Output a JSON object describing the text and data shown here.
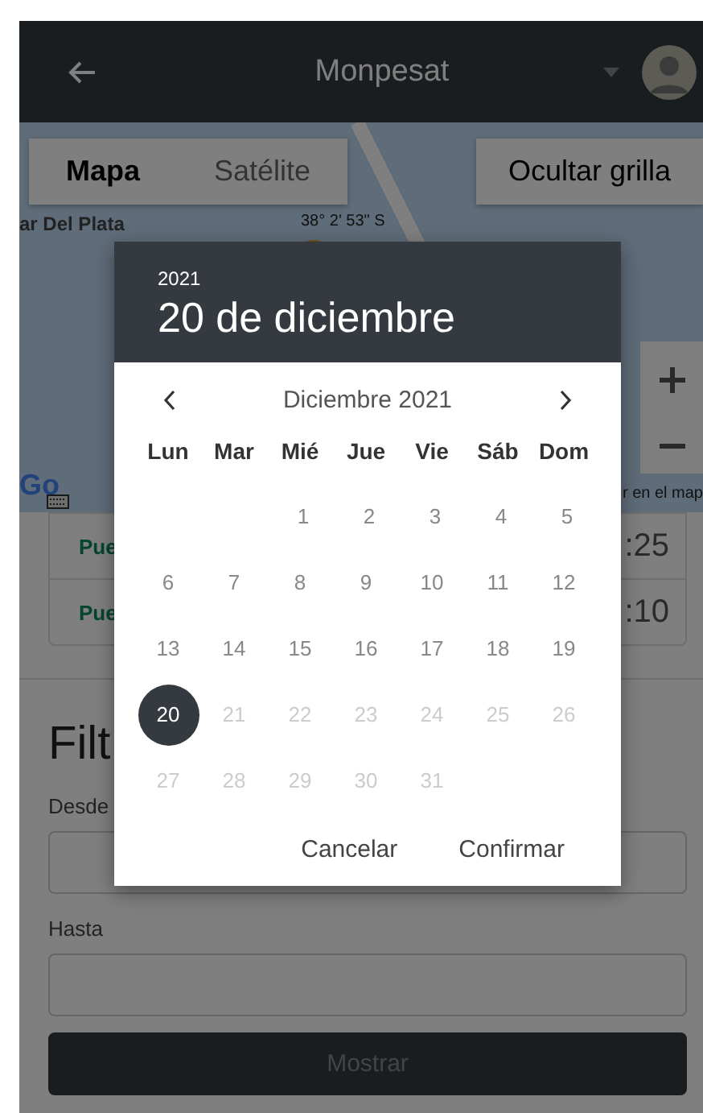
{
  "app_bar": {
    "title": "Monpesat"
  },
  "map": {
    "tabs": [
      {
        "label": "Mapa",
        "selected": true
      },
      {
        "label": "Satélite",
        "selected": false
      }
    ],
    "toggle_button": "Ocultar grilla",
    "place_label": "ar Del Plata",
    "coordinates": "38° 2' 53\" S",
    "logo": "Go",
    "attribution": "r en el map"
  },
  "table": {
    "rows": [
      {
        "column_1": "Pue",
        "column_2": ":25"
      },
      {
        "column_1": "Pue",
        "column_2": ":10"
      }
    ]
  },
  "filter": {
    "heading": "Filt",
    "fields": [
      {
        "label": "Desde"
      },
      {
        "label": "Hasta"
      }
    ],
    "submit": "Mostrar"
  },
  "date_picker": {
    "year": "2021",
    "date": "20 de diciembre",
    "month": "Diciembre 2021",
    "weekdays": [
      "Lun",
      "Mar",
      "Mié",
      "Jue",
      "Vie",
      "Sáb",
      "Dom"
    ],
    "weeks": [
      {
        "kind": "first",
        "days": [
          {
            "label": "1",
            "disabled": false,
            "selected": false
          },
          {
            "label": "2",
            "disabled": false,
            "selected": false
          },
          {
            "label": "3",
            "disabled": false,
            "selected": false
          },
          {
            "label": "4",
            "disabled": false,
            "selected": false
          },
          {
            "label": "5",
            "disabled": false,
            "selected": false
          }
        ]
      },
      {
        "kind": "full",
        "days": [
          {
            "label": "6",
            "disabled": false,
            "selected": false
          },
          {
            "label": "7",
            "disabled": false,
            "selected": false
          },
          {
            "label": "8",
            "disabled": false,
            "selected": false
          },
          {
            "label": "9",
            "disabled": false,
            "selected": false
          },
          {
            "label": "10",
            "disabled": false,
            "selected": false
          },
          {
            "label": "11",
            "disabled": false,
            "selected": false
          },
          {
            "label": "12",
            "disabled": false,
            "selected": false
          }
        ]
      },
      {
        "kind": "full",
        "days": [
          {
            "label": "13",
            "disabled": false,
            "selected": false
          },
          {
            "label": "14",
            "disabled": false,
            "selected": false
          },
          {
            "label": "15",
            "disabled": false,
            "selected": false
          },
          {
            "label": "16",
            "disabled": false,
            "selected": false
          },
          {
            "label": "17",
            "disabled": false,
            "selected": false
          },
          {
            "label": "18",
            "disabled": false,
            "selected": false
          },
          {
            "label": "19",
            "disabled": false,
            "selected": false
          }
        ]
      },
      {
        "kind": "full",
        "days": [
          {
            "label": "20",
            "disabled": false,
            "selected": true
          },
          {
            "label": "21",
            "disabled": true,
            "selected": false
          },
          {
            "label": "22",
            "disabled": true,
            "selected": false
          },
          {
            "label": "23",
            "disabled": true,
            "selected": false
          },
          {
            "label": "24",
            "disabled": true,
            "selected": false
          },
          {
            "label": "25",
            "disabled": true,
            "selected": false
          },
          {
            "label": "26",
            "disabled": true,
            "selected": false
          }
        ]
      },
      {
        "kind": "last",
        "days": [
          {
            "label": "27",
            "disabled": true,
            "selected": false
          },
          {
            "label": "28",
            "disabled": true,
            "selected": false
          },
          {
            "label": "29",
            "disabled": true,
            "selected": false
          },
          {
            "label": "30",
            "disabled": true,
            "selected": false
          },
          {
            "label": "31",
            "disabled": true,
            "selected": false
          }
        ]
      }
    ],
    "buttons": [
      "Cancelar",
      "Confirmar"
    ]
  }
}
